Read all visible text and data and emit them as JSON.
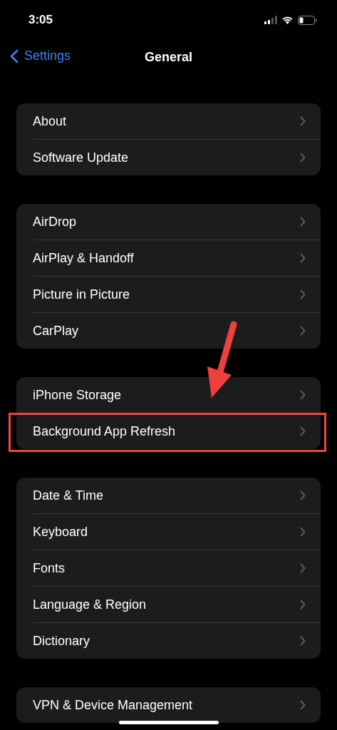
{
  "status_bar": {
    "time": "3:05"
  },
  "nav": {
    "back_label": "Settings",
    "title": "General"
  },
  "groups": [
    {
      "items": [
        {
          "label": "About",
          "highlighted": false
        },
        {
          "label": "Software Update",
          "highlighted": false
        }
      ]
    },
    {
      "items": [
        {
          "label": "AirDrop",
          "highlighted": false
        },
        {
          "label": "AirPlay & Handoff",
          "highlighted": false
        },
        {
          "label": "Picture in Picture",
          "highlighted": false
        },
        {
          "label": "CarPlay",
          "highlighted": false
        }
      ]
    },
    {
      "items": [
        {
          "label": "iPhone Storage",
          "highlighted": false
        },
        {
          "label": "Background App Refresh",
          "highlighted": true
        }
      ]
    },
    {
      "items": [
        {
          "label": "Date & Time",
          "highlighted": false
        },
        {
          "label": "Keyboard",
          "highlighted": false
        },
        {
          "label": "Fonts",
          "highlighted": false
        },
        {
          "label": "Language & Region",
          "highlighted": false
        },
        {
          "label": "Dictionary",
          "highlighted": false
        }
      ]
    },
    {
      "items": [
        {
          "label": "VPN & Device Management",
          "highlighted": false
        }
      ]
    }
  ]
}
